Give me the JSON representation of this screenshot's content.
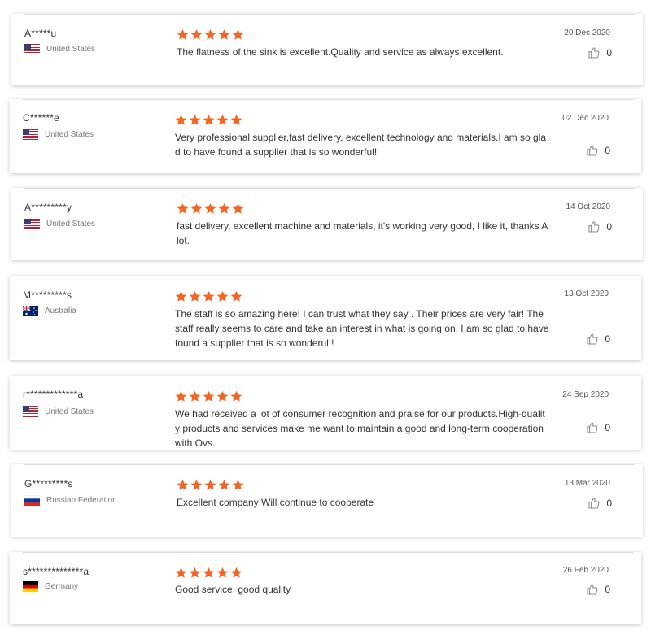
{
  "reviews": [
    {
      "name": "A*****u",
      "country": "United States",
      "flag": "us",
      "rating": 5,
      "text": "The flatness of the sink is excellent.Quality and service as always excellent.",
      "date": "20 Dec 2020",
      "likes": "0"
    },
    {
      "name": "C******e",
      "country": "United States",
      "flag": "us",
      "rating": 5,
      "text": "Very professional supplier,fast delivery, excellent technology and materials.I am so glad to have found a supplier that is so wonderful!",
      "date": "02 Dec 2020",
      "likes": "0"
    },
    {
      "name": "A*********y",
      "country": "United States",
      "flag": "us",
      "rating": 5,
      "text": "fast delivery, excellent machine and materials, it's working very good, I like it, thanks A lot.",
      "date": "14 Oct 2020",
      "likes": "0"
    },
    {
      "name": "M*********s",
      "country": "Australia",
      "flag": "au",
      "rating": 5,
      "text": "The staff is so amazing here! I can trust what they say . Their prices are very fair! The staff really seems to care and take an interest in what is going on. I am so glad to have found a supplier that is so wonderul!!",
      "date": "13 Oct 2020",
      "likes": "0"
    },
    {
      "name": "r*************a",
      "country": "United States",
      "flag": "us",
      "rating": 5,
      "text": "We had received a lot of consumer recognition and praise for our products.High-quality products and services make me want to maintain a good and long-term cooperation with Ovs.",
      "date": "24 Sep 2020",
      "likes": "0"
    },
    {
      "name": "G*********s",
      "country": "Russian Federation",
      "flag": "ru",
      "rating": 5,
      "text": "Excellent company!Will continue to cooperate",
      "date": "13 Mar 2020",
      "likes": "0"
    },
    {
      "name": "s**************a",
      "country": "Germany",
      "flag": "de",
      "rating": 5,
      "text": "Good service, good quality",
      "date": "26 Feb 2020",
      "likes": "0"
    }
  ],
  "colors": {
    "star": "#f26522",
    "flag_us_red": "#b22234",
    "flag_us_blue": "#3c3b6e",
    "flag_au_blue": "#012169",
    "flag_ru_blue": "#0039a6",
    "flag_ru_red": "#d52b1e",
    "flag_de_red": "#dd0000",
    "flag_de_gold": "#ffce00"
  },
  "icons": {
    "like": "thumbs-up-icon",
    "star": "star-icon"
  }
}
